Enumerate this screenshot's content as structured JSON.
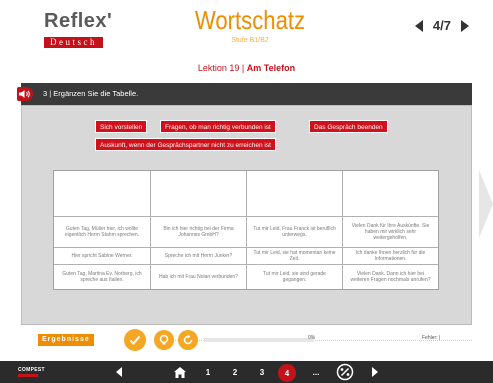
{
  "header": {
    "logo_top": "Reflex'",
    "logo_bottom": "Deutsch",
    "title": "Wortschatz",
    "subtitle": "Stufe B1/B2",
    "page_indicator": "4/7"
  },
  "lesson": {
    "number_label": "Lektion 19 | ",
    "topic": "Am Telefon"
  },
  "task": {
    "text": "3 | Ergänzen Sie die Tabelle."
  },
  "chips": [
    "Sich vorstellen",
    "Fragen, ob man richtig verbunden ist",
    "Das Gespräch beenden",
    "Auskunft, wenn der Gesprächspartner nicht zu erreichen ist"
  ],
  "table": {
    "rows": [
      [
        "Guten Tag, Müller hier, ich wollte eigentlich Herrn Stahm sprechen.",
        "Bin ich hier richtig bei der Firma Johannes GmbH?",
        "Tut mir Leid, Frau Franck ist beruflich unterwegs.",
        "Vielen Dank für Ihre Auskünfte. Sie haben mir wirklich sehr weitergeholfen."
      ],
      [
        "Hier spricht Sabine Werner.",
        "Spreche ich mit Herrn Junker?",
        "Tut mir Leid, sie hat momentan keine Zeit.",
        "Ich danke Ihnen herzlich für die Informationen."
      ],
      [
        "Guten Tag, Martina Ev. Norberg, ich spreche aus Italien.",
        "Hab ich mit Frau Nolan verbunden?",
        "Tut mir Leid, sie sind gerade gegangen.",
        "Vielen Dank. Dann ich hier bei weiteren Fragen nochmals anrufen?"
      ]
    ]
  },
  "results": {
    "label": "Ergebnisse",
    "percent": "0%",
    "errors": "Fehler: |"
  },
  "footer": {
    "logo": "COMPEST",
    "pages": [
      "1",
      "2",
      "3",
      "4",
      "..."
    ],
    "current_page": "4"
  },
  "colors": {
    "brand_red": "#c4121b",
    "accent_orange": "#f08c00",
    "chip_red": "#d0101a",
    "taskbar": "#3a3a3a"
  }
}
